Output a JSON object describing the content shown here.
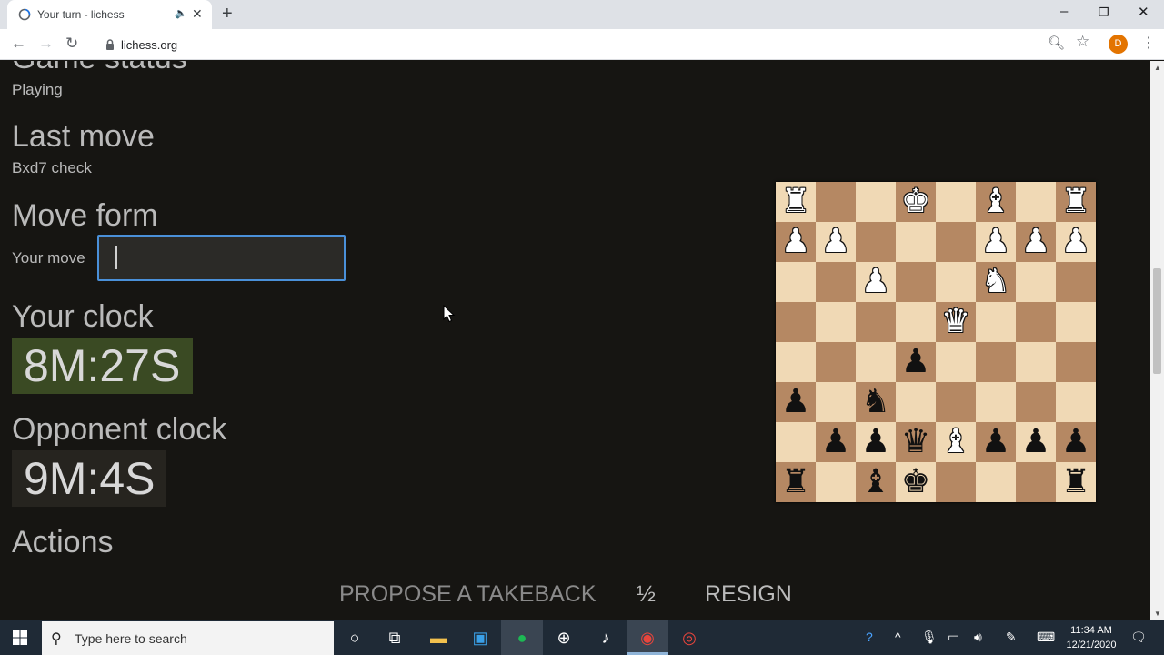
{
  "browser": {
    "tab_title": "Your turn - lichess",
    "tab_close": "✕",
    "new_tab": "+",
    "url": "lichess.org",
    "profile_initial": "D",
    "window": {
      "minimize": "–",
      "maximize": "❐",
      "close": "✕"
    }
  },
  "page": {
    "game_status_heading": "Game status",
    "game_status": "Playing",
    "last_move_heading": "Last move",
    "last_move": "Bxd7 check",
    "move_form_heading": "Move form",
    "your_move_label": "Your move",
    "move_input_value": "",
    "your_clock_heading": "Your clock",
    "your_clock": "8M:27S",
    "opponent_clock_heading": "Opponent clock",
    "opponent_clock": "9M:4S",
    "actions_heading": "Actions",
    "actions": {
      "takeback": "PROPOSE A TAKEBACK",
      "draw": "½",
      "resign": "RESIGN"
    }
  },
  "board": {
    "orientation": "black-bottom",
    "ranks": [
      [
        "wR",
        "",
        "",
        "wK",
        "",
        "wB",
        "",
        "wR"
      ],
      [
        "wP",
        "wP",
        "",
        "",
        "",
        "wP",
        "wP",
        "wP"
      ],
      [
        "",
        "",
        "wP",
        "",
        "",
        "wN",
        "",
        ""
      ],
      [
        "",
        "",
        "",
        "",
        "wQ",
        "",
        "",
        ""
      ],
      [
        "",
        "",
        "",
        "bP",
        "",
        "",
        "",
        ""
      ],
      [
        "bP",
        "",
        "bN",
        "",
        "",
        "",
        "",
        ""
      ],
      [
        "",
        "bP",
        "bP",
        "bQ",
        "wB",
        "bP",
        "bP",
        "bP"
      ],
      [
        "bR",
        "",
        "bB",
        "bK",
        "",
        "",
        "",
        "bR"
      ]
    ],
    "colors": {
      "light": "#f0d9b5",
      "dark": "#b58863"
    }
  },
  "taskbar": {
    "search_placeholder": "Type here to search",
    "time": "11:34 AM",
    "date": "12/21/2020"
  }
}
